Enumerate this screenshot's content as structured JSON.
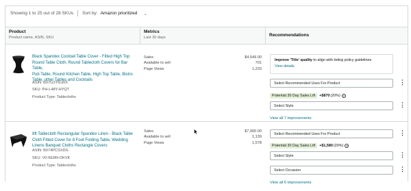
{
  "topbar": {
    "showing": "Showing 1 to 25 out of 28 SKUs",
    "sort_label": "Sort by:",
    "sort_value": "Amazon prioritized"
  },
  "header": {
    "product": "Product",
    "product_sub": "Product name, ASIN, SKU",
    "metrics": "Metrics",
    "metrics_sub": "Last 30 days",
    "recs": "Recommendations"
  },
  "products": [
    {
      "title_lines": [
        "Black Spandex Cocktail Table Cover - Fitted High Top",
        "Round Table Cloth,  Round Tablecloth Covers for Bar Table,",
        "Pub Table, Round Kitchen Table, High Top Table, Bistro",
        "Table, other Tables and Cocktails"
      ],
      "asin": "ASIN: B07G3T6LWX",
      "sku": "SKU: PH-L48Y-HYQT",
      "type": "Product Type: Tablecloths",
      "metric_labels": [
        "Sales",
        "Available to sell",
        "Page Views"
      ],
      "metric_values": [
        "$4,549.00",
        "701",
        "1,233"
      ],
      "guidance_bold": "Improve 'Title' quality",
      "guidance_rest": " to align with listing policy guidelines",
      "guidance_link": "View details",
      "select1": "Select Recommended Uses For Product",
      "lift_label": "Potential 30 Day Sales Lift",
      "lift_value": "+$870",
      "lift_pct": " (20%)",
      "select2": "Select Style",
      "view_all": "View all 7 improvements"
    },
    {
      "title_lines": [
        "8ft Tablecloth Rectangular Spandex Linen - Black Table",
        "Cloth Fitted Cover for 8 Foot Folding Table, Wedding",
        "Linens Banquet Cloths Rectangle Covers"
      ],
      "asin": "ASIN: B074PCSXDG",
      "sku": "SKU: V0-KE8N-OKVK",
      "type": "Product Type: Tablecloths",
      "metric_labels": [
        "Sales",
        "Available to sell",
        "Page Views"
      ],
      "metric_values": [
        "$7,900.00",
        "1,139",
        "1,578"
      ],
      "select1": "Select Recommended Uses For Product",
      "lift_label": "Potential 30 Day Sales Lift",
      "lift_value": "+$1,580",
      "lift_pct": " (20%)",
      "select2": "Select Style",
      "select3": "Select Occasion",
      "view_all": "View all 6 improvements"
    }
  ],
  "icons": {
    "sort_chevron": "chevron-down-icon",
    "kebab": "more-options-icon",
    "info": "info-icon"
  },
  "colors": {
    "link": "#007185",
    "lift_pill": "#e3f1d8",
    "border": "#d5d9d9"
  }
}
